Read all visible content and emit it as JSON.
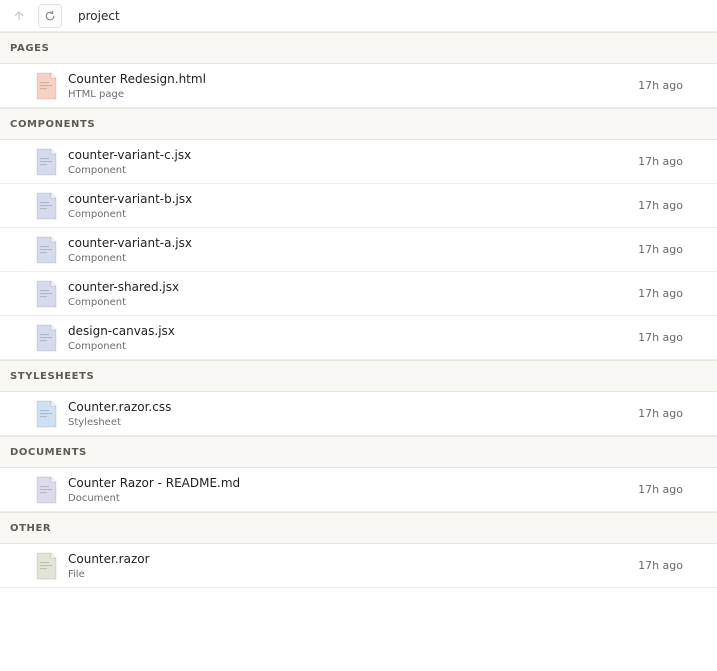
{
  "toolbar": {
    "up_icon": "arrow-up-icon",
    "refresh_icon": "refresh-icon",
    "path": "project"
  },
  "sections": [
    {
      "title": "PAGES",
      "items": [
        {
          "name": "Counter Redesign.html",
          "type": "HTML page",
          "modified": "17h ago",
          "icon": "html-file-icon",
          "icon_color": "#f6d2c4"
        }
      ]
    },
    {
      "title": "COMPONENTS",
      "items": [
        {
          "name": "counter-variant-c.jsx",
          "type": "Component",
          "modified": "17h ago",
          "icon": "component-file-icon",
          "icon_color": "#d5dbec"
        },
        {
          "name": "counter-variant-b.jsx",
          "type": "Component",
          "modified": "17h ago",
          "icon": "component-file-icon",
          "icon_color": "#d5dbec"
        },
        {
          "name": "counter-variant-a.jsx",
          "type": "Component",
          "modified": "17h ago",
          "icon": "component-file-icon",
          "icon_color": "#d5dbec"
        },
        {
          "name": "counter-shared.jsx",
          "type": "Component",
          "modified": "17h ago",
          "icon": "component-file-icon",
          "icon_color": "#d5dbec"
        },
        {
          "name": "design-canvas.jsx",
          "type": "Component",
          "modified": "17h ago",
          "icon": "component-file-icon",
          "icon_color": "#d5dbec"
        }
      ]
    },
    {
      "title": "STYLESHEETS",
      "items": [
        {
          "name": "Counter.razor.css",
          "type": "Stylesheet",
          "modified": "17h ago",
          "icon": "stylesheet-file-icon",
          "icon_color": "#cfe0f3"
        }
      ]
    },
    {
      "title": "DOCUMENTS",
      "items": [
        {
          "name": "Counter Razor - README.md",
          "type": "Document",
          "modified": "17h ago",
          "icon": "document-file-icon",
          "icon_color": "#dedaec"
        }
      ]
    },
    {
      "title": "OTHER",
      "items": [
        {
          "name": "Counter.razor",
          "type": "File",
          "modified": "17h ago",
          "icon": "generic-file-icon",
          "icon_color": "#e4e3d8"
        }
      ]
    }
  ]
}
